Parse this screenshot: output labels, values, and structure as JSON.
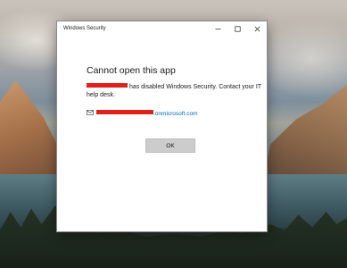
{
  "window": {
    "title": "Windows Security",
    "controls": {
      "minimize": "minimize-icon",
      "maximize": "maximize-icon",
      "close": "close-icon"
    }
  },
  "dialog": {
    "heading": "Cannot open this app",
    "message_after_redaction": " has disabled Windows Security. Contact your IT help desk.",
    "email_domain": ".onmicrosoft.com",
    "ok_label": "OK"
  },
  "colors": {
    "redaction": "#e0201b",
    "link": "#0067b8",
    "button_bg": "#cccccc"
  }
}
